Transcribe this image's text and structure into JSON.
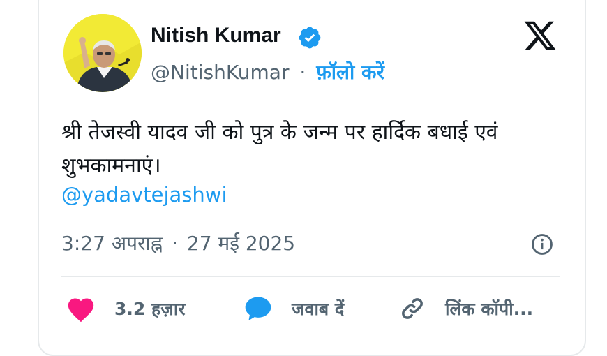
{
  "author": {
    "name": "Nitish Kumar",
    "handle": "@NitishKumar",
    "separator": "·",
    "follow_label": "फ़ॉलो करें",
    "verified": true
  },
  "tweet": {
    "text": "श्री तेजस्वी यादव जी को पुत्र के जन्म पर हार्दिक बधाई एवं शुभकामनाएं।",
    "mention": "@yadavtejashwi",
    "time": "3:27 अपराह्न",
    "date": "27 मई 2025",
    "separator": "·"
  },
  "actions": {
    "like_count": "3.2 हज़ार",
    "reply_label": "जवाब दें",
    "copy_link_label": "लिंक कॉपी..."
  },
  "colors": {
    "accent": "#1d9bf0",
    "like": "#f91880",
    "text": "#0f1419",
    "muted": "#536471",
    "border": "#e6e9eb"
  },
  "icons": [
    "avatar",
    "verified-badge-icon",
    "x-logo-icon",
    "info-icon",
    "heart-icon",
    "reply-bubble-icon",
    "link-icon"
  ]
}
